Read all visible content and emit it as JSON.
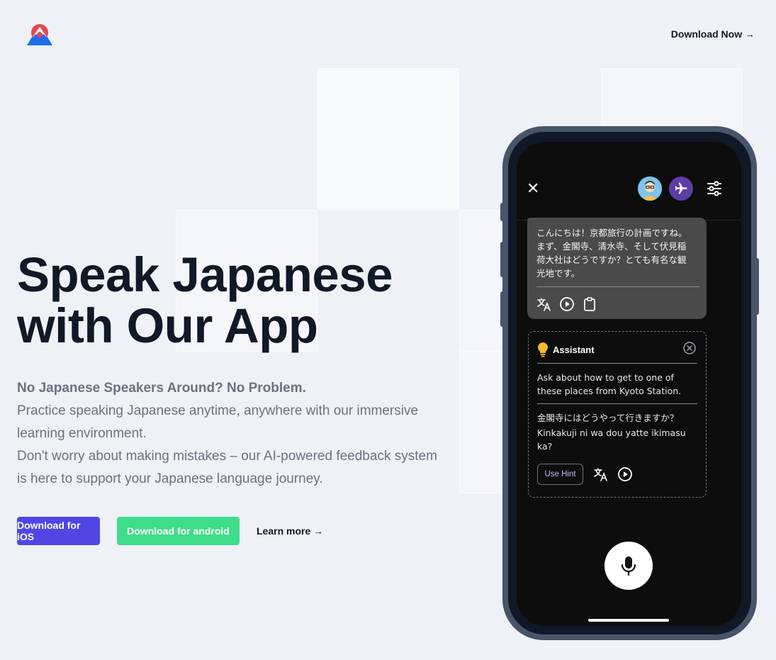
{
  "header": {
    "logo_icon": "mountain-logo-icon",
    "download_now": "Download Now →"
  },
  "hero": {
    "title_line1": "Speak Japanese",
    "title_line2": "with Our App",
    "lead": "No Japanese Speakers Around? No Problem.",
    "para1_line1": "Practice speaking Japanese anytime, anywhere with our immersive",
    "para1_line2": "learning environment.",
    "para2_line1": "Don't worry about making mistakes – our AI-powered feedback system",
    "para2_line2": "is here to support your Japanese language journey."
  },
  "buttons": {
    "ios": "Download for iOS",
    "android": "Download for android",
    "learn_more": "Learn more →"
  },
  "phone": {
    "chat": {
      "message_line1": "こんにちは！京都旅行の計画ですね。",
      "message_line2": "まず、金閣寺、清水寺、そして伏見稲",
      "message_line3": "荷大社はどうですか？とても有名な観",
      "message_line4": "光地です。"
    },
    "assistant": {
      "title": "Assistant",
      "hint_line1": "Ask about how to get to one of",
      "hint_line2": "these places from Kyoto Station.",
      "japanese": "金閣寺にはどうやって行きますか？",
      "romaji_line1": "Kinkakuji ni wa dou yatte ikimasu",
      "romaji_line2": "ka?",
      "use_hint": "Use Hint"
    }
  },
  "colors": {
    "background": "#eef1f6",
    "ios_button": "#4f46e5",
    "android_button": "#3fdc8a",
    "phone_frame": "#475569",
    "screen": "#0d0d0d",
    "bubble": "#4a4a4a"
  }
}
